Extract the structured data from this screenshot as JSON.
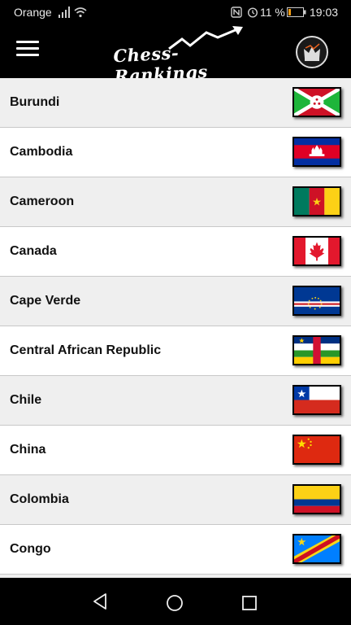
{
  "status_bar": {
    "carrier": "Orange",
    "battery_percent": "11 %",
    "time": "19:03"
  },
  "app_bar": {
    "logo_text": "Chess-Rankings",
    "menu_icon": "hamburger-menu-icon",
    "action_icon": "king-crown-icon"
  },
  "countries": [
    {
      "name": "Burundi",
      "flag": "burundi-flag"
    },
    {
      "name": "Cambodia",
      "flag": "cambodia-flag"
    },
    {
      "name": "Cameroon",
      "flag": "cameroon-flag"
    },
    {
      "name": "Canada",
      "flag": "canada-flag"
    },
    {
      "name": "Cape Verde",
      "flag": "cape-verde-flag"
    },
    {
      "name": "Central African Republic",
      "flag": "central-african-republic-flag"
    },
    {
      "name": "Chile",
      "flag": "chile-flag"
    },
    {
      "name": "China",
      "flag": "china-flag"
    },
    {
      "name": "Colombia",
      "flag": "colombia-flag"
    },
    {
      "name": "Congo",
      "flag": "congo-flag"
    }
  ],
  "colors": {
    "background": "#000000",
    "row_light": "#ffffff",
    "row_alt": "#efefef",
    "battery_low": "#f39c12"
  }
}
